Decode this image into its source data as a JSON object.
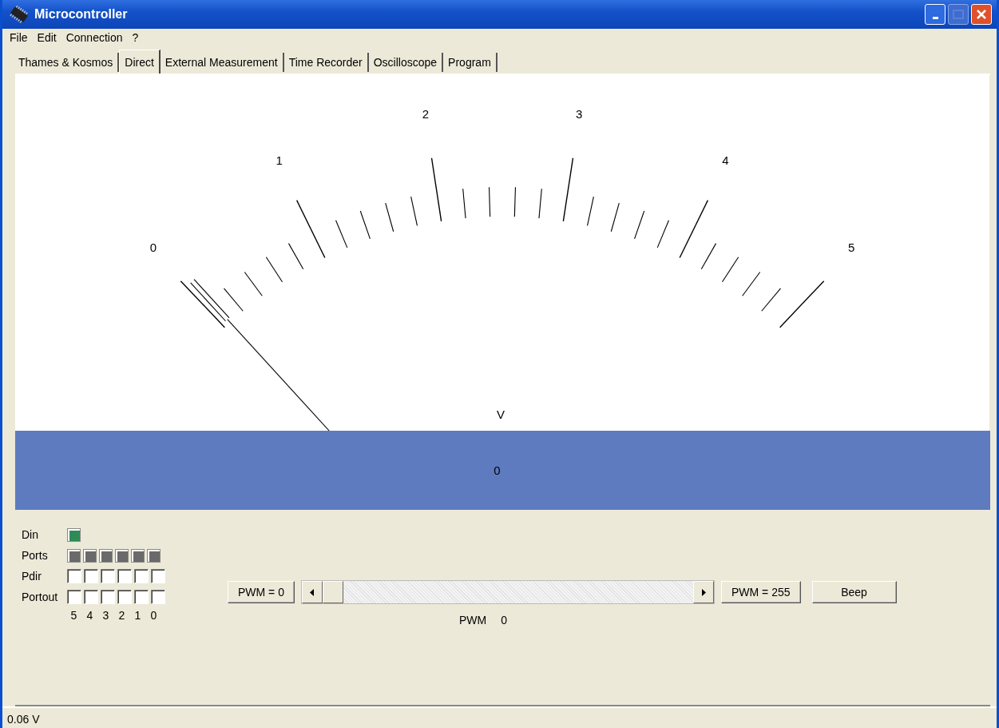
{
  "window": {
    "title": "Microcontroller"
  },
  "menu": [
    "File",
    "Edit",
    "Connection",
    "?"
  ],
  "tabs": [
    {
      "label": "Thames & Kosmos",
      "selected": false
    },
    {
      "label": "Direct",
      "selected": true
    },
    {
      "label": "External Measurement",
      "selected": false
    },
    {
      "label": "Time Recorder",
      "selected": false
    },
    {
      "label": "Oscilloscope",
      "selected": false
    },
    {
      "label": "Program",
      "selected": false
    }
  ],
  "meter": {
    "scale_labels": [
      "0",
      "1",
      "2",
      "3",
      "4",
      "5"
    ],
    "unit": "V"
  },
  "display": {
    "value": "0"
  },
  "indicators": [
    {
      "label": "Din",
      "kind": "led",
      "cells": [
        {
          "on": true
        }
      ]
    },
    {
      "label": "Ports",
      "kind": "led",
      "cells": [
        {
          "on": true
        },
        {
          "on": true
        },
        {
          "on": true
        },
        {
          "on": true
        },
        {
          "on": true
        },
        {
          "on": true
        }
      ]
    },
    {
      "label": "Pdir",
      "kind": "checkbox",
      "cells": [
        {
          "on": false
        },
        {
          "on": false
        },
        {
          "on": false
        },
        {
          "on": false
        },
        {
          "on": false
        },
        {
          "on": false
        }
      ]
    },
    {
      "label": "Portout",
      "kind": "checkbox",
      "cells": [
        {
          "on": false
        },
        {
          "on": false
        },
        {
          "on": false
        },
        {
          "on": false
        },
        {
          "on": false
        },
        {
          "on": false
        }
      ]
    }
  ],
  "bit_labels": [
    "5",
    "4",
    "3",
    "2",
    "1",
    "0"
  ],
  "pwm": {
    "min_button": "PWM = 0",
    "max_button": "PWM = 255",
    "beep_button": "Beep",
    "level": 0,
    "caption": "PWM",
    "reading": "0"
  },
  "status_bar": "0.06 V"
}
